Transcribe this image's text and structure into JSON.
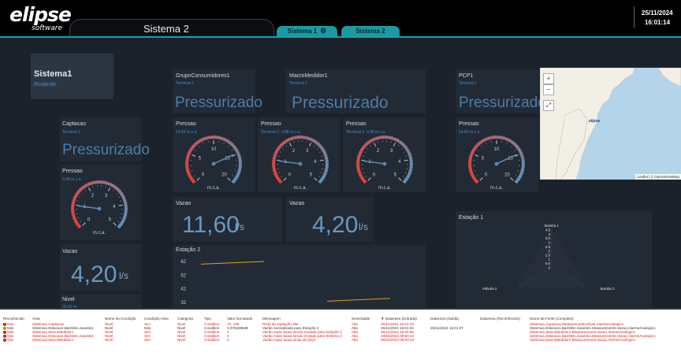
{
  "header": {
    "logo_main": "elipse",
    "logo_sub": "software",
    "screen_title": "Sistema 2",
    "tabs": [
      {
        "label": "Sistema 1"
      },
      {
        "label": "Sistema 2"
      }
    ],
    "date": "25/11/2024",
    "time": "16:01:14"
  },
  "system": {
    "name": "Sistema1",
    "state": "Rodando"
  },
  "captacao": {
    "title": "Captacao",
    "sub": "Terminal 1",
    "status": "Pressurizado"
  },
  "captacao_pressao": {
    "title": "Pressao",
    "sub": "0,98 m.c.a.",
    "unit": "m.c.a.",
    "ticks": [
      "0",
      "1",
      "2",
      "3",
      "4",
      "5"
    ],
    "value": 0.98,
    "max": 5
  },
  "captacao_vazao": {
    "title": "Vazao",
    "value": "4,20",
    "unit": "l/s"
  },
  "captacao_nivel": {
    "title": "Nivel",
    "sub": "29,20 m"
  },
  "grupo": {
    "title": "GrupoConsumidores1",
    "sub": "Terminal 1",
    "status": "Pressurizado"
  },
  "grupo_pressao": {
    "title": "Pressao",
    "sub": "14,83 m.c.a.",
    "unit": "m.c.a.",
    "ticks": [
      "0",
      "5",
      "10",
      "15",
      "20"
    ],
    "value": 14.83,
    "max": 20
  },
  "grupo_vazao": {
    "title": "Vazao",
    "value": "11,60",
    "unit": "l/s"
  },
  "macro": {
    "title": "MacroMedidor1",
    "sub": "Terminal 1",
    "status": "Pressurizado"
  },
  "macro_pressao1": {
    "title": "Pressao",
    "sub": "Terminal 1: 0,98 m.c.a.",
    "unit": "m.c.a.",
    "ticks": [
      "0",
      "1",
      "2",
      "3",
      "4",
      "5"
    ],
    "value": 0.98,
    "max": 5
  },
  "macro_pressao2": {
    "title": "Pressao",
    "sub": "Terminal 2: 0,98 m.c.a.",
    "unit": "m.c.a.",
    "ticks": [
      "0",
      "1",
      "2",
      "3",
      "4",
      "5"
    ],
    "value": 0.98,
    "max": 5
  },
  "macro_vazao": {
    "title": "Vazao",
    "value": "4,20",
    "unit": "l/s"
  },
  "pcp": {
    "title": "PCP1",
    "sub": "Terminal 1",
    "status": "Pressurizado"
  },
  "pcp_pressao": {
    "title": "Pressao",
    "sub": "14,83 m.c.a.",
    "unit": "m.c.a.",
    "ticks": [
      "0",
      "5",
      "10",
      "15",
      "20"
    ],
    "value": 14.83,
    "max": 20
  },
  "map": {
    "zoom_in": "+",
    "zoom_out": "−",
    "fullscreen": "⤢",
    "marker": "elipse",
    "attribution": "Leaflet | © OpenStreetMap"
  },
  "chart_data": [
    {
      "type": "line",
      "title": "Estação 2",
      "yticks": [
        "62",
        "52",
        "42",
        "32"
      ],
      "ylim": [
        28,
        66
      ],
      "series": [
        {
          "color": "#e8a020",
          "x": [
            0,
            1
          ],
          "y": [
            60,
            62
          ]
        },
        {
          "color": "#e8a020",
          "x": [
            2,
            3
          ],
          "y": [
            33,
            35
          ]
        }
      ]
    },
    {
      "type": "radar",
      "title": "Estação 1",
      "axes": [
        "Bomba 1",
        "Bomba 2",
        "Válvula 2"
      ],
      "ticks": [
        "4.5",
        "4",
        "3.5",
        "3",
        "2.5",
        "2",
        "1.5",
        "1",
        "0.5",
        "0"
      ],
      "rmax": 4.5
    }
  ],
  "alarms": {
    "columns": [
      "Reconhecido",
      "Área",
      "Nome da Condição",
      "Condição Ativa",
      "Categoria",
      "Tipo",
      "Valor formatado",
      "Mensagem",
      "Severidade",
      "▼ DataHora (Entrada)",
      "DataHora (Saída)",
      "DataHora (Reconhecido)",
      "Nome da Fonte (Completo)"
    ],
    "rows": [
      {
        "state": "active",
        "cells": [
          "Não",
          "Sistema1.Captacao",
          "Nivel",
          "Sim",
          "Nivel",
          "Condition",
          "70, 196",
          "Nível da captação alta",
          "Alta",
          "25/11/2024 16:01:10",
          "",
          "",
          "Sistema1.Captacao.Measurements.Nivel.AlarmeAnalogico"
        ]
      },
      {
        "state": "normal",
        "cells": [
          "Não",
          "Sistema1.Estacao1.Barrilete.Jusante1",
          "Nivel",
          "Não",
          "Nivel",
          "Condition",
          "3,075438638",
          "Vazão normalizada para Estação 2",
          "Alta",
          "25/11/2024 16:01:04",
          "25/11/2024 16:01:07",
          "",
          "Sistema1.Estacao1.Barrilete.Jusante1.Measurements.Vazao.AlarmeAnalogico"
        ]
      },
      {
        "state": "active",
        "cells": [
          "Não",
          "Sistema1.MacroMedidor1",
          "Nivel",
          "Sim",
          "Nivel",
          "Condition",
          "0",
          "Vazão muito baixa sendo enviada para Estação 1",
          "Alta",
          "25/11/2024 15:43:55",
          "",
          "",
          "Sistema1.MacroMedidor1.Measurements.Vazao.AlarmeAnalogico"
        ]
      },
      {
        "state": "active",
        "cells": [
          "Não",
          "Sistema1.Estacao1.Barrilete.Jusante2",
          "Nivel",
          "Sim",
          "Nivel",
          "Condition",
          "0",
          "Vazão muito baixa sendo enviada para Sistema 2",
          "Alta",
          "23/04/2024 09:50:24",
          "",
          "",
          "Sistema1.Estacao1.Barrilete.Jusante2.Measurements.Vazao.AlarmeAnalogico"
        ]
      },
      {
        "state": "active",
        "cells": [
          "Não",
          "Sistema2.MacroMedidor1",
          "Nivel",
          "Sim",
          "Nivel",
          "Condition",
          "0",
          "Vazão muito baixa vinda do poço",
          "Alta",
          "08/04/2024 08:34:03",
          "",
          "",
          "Sistema2.MacroMedidor1.Measurements.Vazao.AlarmeAnalogico"
        ]
      }
    ]
  }
}
